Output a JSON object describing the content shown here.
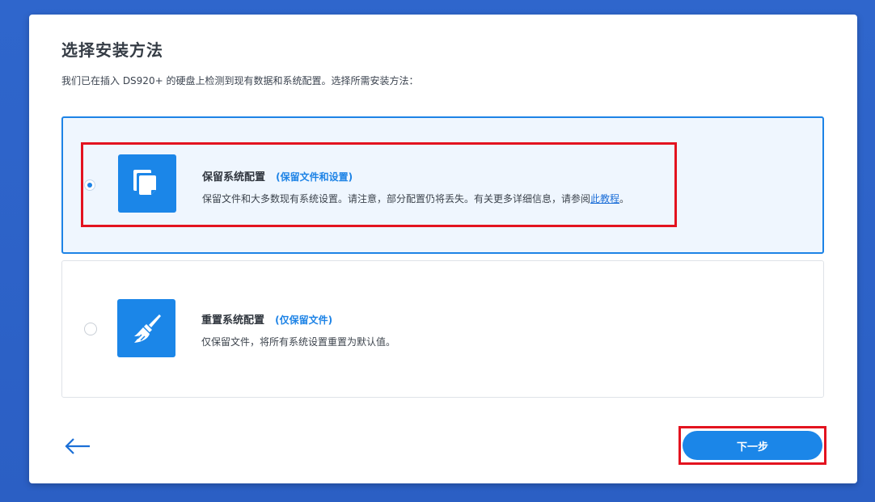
{
  "dialog": {
    "title": "选择安装方法",
    "subtitle": "我们已在插入 DS920+ 的硬盘上检测到现有数据和系统配置。选择所需安装方法："
  },
  "options": [
    {
      "title": "保留系统配置",
      "tag": "(保留文件和设置)",
      "desc_before": "保留文件和大多数现有系统设置。请注意，部分配置仍将丢失。有关更多详细信息，请参阅",
      "link_label": "此教程",
      "desc_after": "。",
      "selected": true,
      "icon": "copy-icon"
    },
    {
      "title": "重置系统配置",
      "tag": "(仅保留文件)",
      "desc": "仅保留文件，将所有系统设置重置为默认值。",
      "selected": false,
      "icon": "broom-icon"
    }
  ],
  "footer": {
    "back_icon": "arrow-left-icon",
    "next_label": "下一步"
  },
  "colors": {
    "accent": "#1b86e8",
    "highlight_annotation": "#e3131f",
    "background": "#2f65c9"
  }
}
